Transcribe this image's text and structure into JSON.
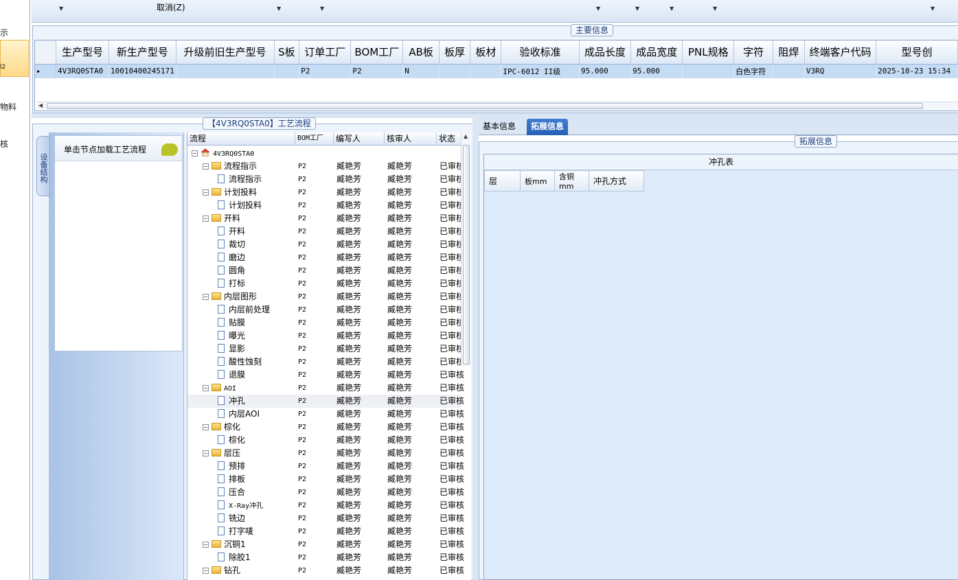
{
  "left_nav": {
    "items": [
      "示",
      "l2",
      "物料",
      "核"
    ]
  },
  "toolbar": {
    "cancel": "取消(Z)"
  },
  "main_info": {
    "title": "主要信息",
    "columns": [
      "生产型号",
      "新生产型号",
      "升级前旧生产型号",
      "S板",
      "订单工厂",
      "BOM工厂",
      "AB板",
      "板厚",
      "板材",
      "验收标准",
      "成品长度",
      "成品宽度",
      "PNL规格",
      "字符",
      "阻焊",
      "终端客户代码",
      "型号创"
    ],
    "rows": [
      [
        "4V3RQ0STA0",
        "10010400245171",
        "",
        "",
        "P2",
        "P2",
        "N",
        "",
        "",
        "IPC-6012 II级",
        "95.000",
        "95.000",
        "",
        "白色字符",
        "",
        "V3RQ",
        "2025-10-23 15:34"
      ]
    ]
  },
  "process": {
    "title": "【4V3RQ0STA0】工艺流程",
    "vertical_tab": "设备结构",
    "hint": "单击节点加载工艺流程",
    "columns": [
      "流程",
      "BOM工厂",
      "编写人",
      "核审人",
      "状态"
    ],
    "nodes": [
      {
        "name": "4V3RQ0STA0",
        "level": 0,
        "type": "root",
        "factory": "",
        "writer": "",
        "reviewer": "",
        "status": ""
      },
      {
        "name": "流程指示",
        "level": 1,
        "type": "folder",
        "factory": "P2",
        "writer": "臧艳芳",
        "reviewer": "臧艳芳",
        "status": "已审核"
      },
      {
        "name": "流程指示",
        "level": 2,
        "type": "doc",
        "factory": "P2",
        "writer": "臧艳芳",
        "reviewer": "臧艳芳",
        "status": "已审核"
      },
      {
        "name": "计划投料",
        "level": 1,
        "type": "folder",
        "factory": "P2",
        "writer": "臧艳芳",
        "reviewer": "臧艳芳",
        "status": "已审核"
      },
      {
        "name": "计划投料",
        "level": 2,
        "type": "doc",
        "factory": "P2",
        "writer": "臧艳芳",
        "reviewer": "臧艳芳",
        "status": "已审核"
      },
      {
        "name": "开料",
        "level": 1,
        "type": "folder",
        "factory": "P2",
        "writer": "臧艳芳",
        "reviewer": "臧艳芳",
        "status": "已审核"
      },
      {
        "name": "开料",
        "level": 2,
        "type": "doc",
        "factory": "P2",
        "writer": "臧艳芳",
        "reviewer": "臧艳芳",
        "status": "已审核"
      },
      {
        "name": "裁切",
        "level": 2,
        "type": "doc",
        "factory": "P2",
        "writer": "臧艳芳",
        "reviewer": "臧艳芳",
        "status": "已审核"
      },
      {
        "name": "磨边",
        "level": 2,
        "type": "doc",
        "factory": "P2",
        "writer": "臧艳芳",
        "reviewer": "臧艳芳",
        "status": "已审核"
      },
      {
        "name": "圆角",
        "level": 2,
        "type": "doc",
        "factory": "P2",
        "writer": "臧艳芳",
        "reviewer": "臧艳芳",
        "status": "已审核"
      },
      {
        "name": "打标",
        "level": 2,
        "type": "doc",
        "factory": "P2",
        "writer": "臧艳芳",
        "reviewer": "臧艳芳",
        "status": "已审核"
      },
      {
        "name": "内层图形",
        "level": 1,
        "type": "folder",
        "factory": "P2",
        "writer": "臧艳芳",
        "reviewer": "臧艳芳",
        "status": "已审核"
      },
      {
        "name": "内层前处理",
        "level": 2,
        "type": "doc",
        "factory": "P2",
        "writer": "臧艳芳",
        "reviewer": "臧艳芳",
        "status": "已审核"
      },
      {
        "name": "贴膜",
        "level": 2,
        "type": "doc",
        "factory": "P2",
        "writer": "臧艳芳",
        "reviewer": "臧艳芳",
        "status": "已审核"
      },
      {
        "name": "曝光",
        "level": 2,
        "type": "doc",
        "factory": "P2",
        "writer": "臧艳芳",
        "reviewer": "臧艳芳",
        "status": "已审核"
      },
      {
        "name": "显影",
        "level": 2,
        "type": "doc",
        "factory": "P2",
        "writer": "臧艳芳",
        "reviewer": "臧艳芳",
        "status": "已审核"
      },
      {
        "name": "酸性蚀刻",
        "level": 2,
        "type": "doc",
        "factory": "P2",
        "writer": "臧艳芳",
        "reviewer": "臧艳芳",
        "status": "已审核"
      },
      {
        "name": "退膜",
        "level": 2,
        "type": "doc",
        "factory": "P2",
        "writer": "臧艳芳",
        "reviewer": "臧艳芳",
        "status": "已审核"
      },
      {
        "name": "AOI",
        "level": 1,
        "type": "folder",
        "factory": "P2",
        "writer": "臧艳芳",
        "reviewer": "臧艳芳",
        "status": "已审核"
      },
      {
        "name": "冲孔",
        "level": 2,
        "type": "doc",
        "factory": "P2",
        "writer": "臧艳芳",
        "reviewer": "臧艳芳",
        "status": "已审核",
        "selected": true
      },
      {
        "name": "内层AOI",
        "level": 2,
        "type": "doc",
        "factory": "P2",
        "writer": "臧艳芳",
        "reviewer": "臧艳芳",
        "status": "已审核"
      },
      {
        "name": "棕化",
        "level": 1,
        "type": "folder",
        "factory": "P2",
        "writer": "臧艳芳",
        "reviewer": "臧艳芳",
        "status": "已审核"
      },
      {
        "name": "棕化",
        "level": 2,
        "type": "doc",
        "factory": "P2",
        "writer": "臧艳芳",
        "reviewer": "臧艳芳",
        "status": "已审核"
      },
      {
        "name": "层压",
        "level": 1,
        "type": "folder",
        "factory": "P2",
        "writer": "臧艳芳",
        "reviewer": "臧艳芳",
        "status": "已审核"
      },
      {
        "name": "预排",
        "level": 2,
        "type": "doc",
        "factory": "P2",
        "writer": "臧艳芳",
        "reviewer": "臧艳芳",
        "status": "已审核"
      },
      {
        "name": "排板",
        "level": 2,
        "type": "doc",
        "factory": "P2",
        "writer": "臧艳芳",
        "reviewer": "臧艳芳",
        "status": "已审核"
      },
      {
        "name": "压合",
        "level": 2,
        "type": "doc",
        "factory": "P2",
        "writer": "臧艳芳",
        "reviewer": "臧艳芳",
        "status": "已审核"
      },
      {
        "name": "X-Ray冲孔",
        "level": 2,
        "type": "doc",
        "factory": "P2",
        "writer": "臧艳芳",
        "reviewer": "臧艳芳",
        "status": "已审核"
      },
      {
        "name": "铣边",
        "level": 2,
        "type": "doc",
        "factory": "P2",
        "writer": "臧艳芳",
        "reviewer": "臧艳芳",
        "status": "已审核"
      },
      {
        "name": "打字唛",
        "level": 2,
        "type": "doc",
        "factory": "P2",
        "writer": "臧艳芳",
        "reviewer": "臧艳芳",
        "status": "已审核"
      },
      {
        "name": "沉铜1",
        "level": 1,
        "type": "folder",
        "factory": "P2",
        "writer": "臧艳芳",
        "reviewer": "臧艳芳",
        "status": "已审核"
      },
      {
        "name": "除胶1",
        "level": 2,
        "type": "doc",
        "factory": "P2",
        "writer": "臧艳芳",
        "reviewer": "臧艳芳",
        "status": "已审核"
      },
      {
        "name": "钻孔",
        "level": 1,
        "type": "folder",
        "factory": "P2",
        "writer": "臧艳芳",
        "reviewer": "臧艳芳",
        "status": "已审核"
      }
    ]
  },
  "tabs": [
    {
      "label": "基本信息",
      "active": false
    },
    {
      "label": "拓展信息",
      "active": true
    }
  ],
  "ext_info": {
    "title": "拓展信息",
    "punch_table": {
      "title": "冲孔表",
      "columns": [
        "层",
        "板mm",
        "含铜mm",
        "冲孔方式"
      ]
    }
  },
  "colors": {
    "selection": "#c5dcf5",
    "tab_active": "#2f6cc3",
    "panel_bg": "#ddebfb",
    "frame": "#9db3d2"
  }
}
